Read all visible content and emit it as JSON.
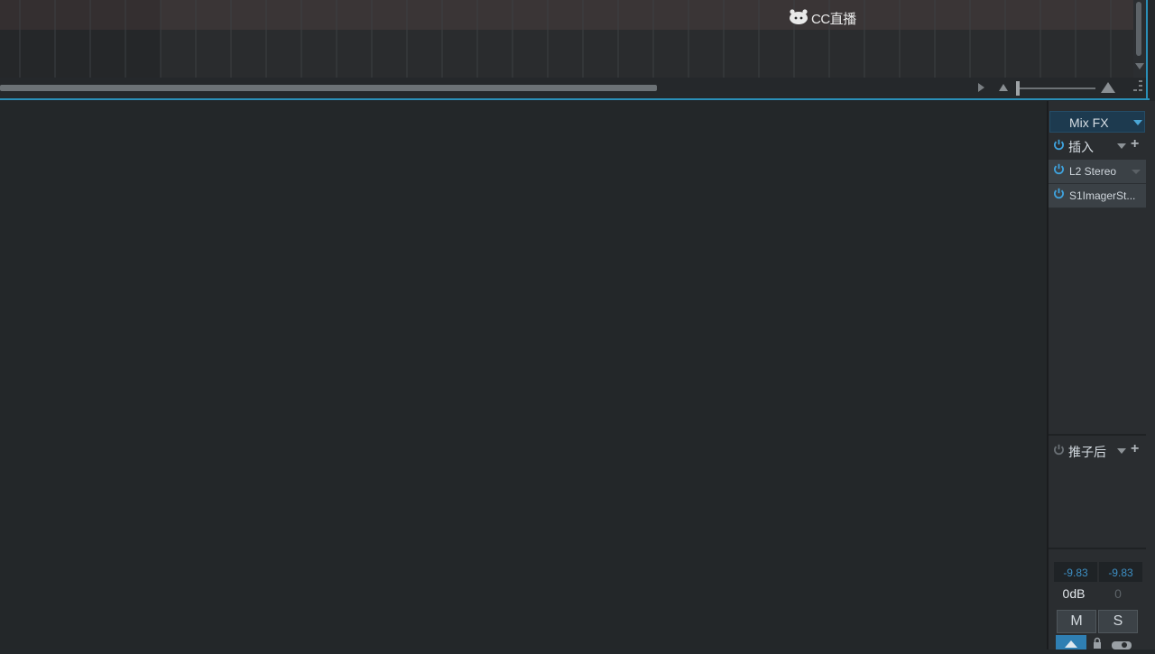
{
  "watermark": {
    "text": "CC直播"
  },
  "mixer": {
    "mixfx_label": "Mix FX",
    "inserts_label": "插入",
    "post_fader_label": "推子后",
    "inserts": [
      {
        "name": "L2 Stereo"
      },
      {
        "name": "S1ImagerSt..."
      }
    ],
    "meter_left": "-9.83",
    "meter_right": "-9.83",
    "volume": "0dB",
    "pan": "0",
    "mute_label": "M",
    "solo_label": "S"
  },
  "colors": {
    "accent": "#2a8fb8",
    "power_on": "#3fa2dd",
    "meter_text": "#3d8fc4",
    "panel_bg": "#2a2d30",
    "main_bg": "#232729"
  },
  "icons": [
    "cc-logo-icon",
    "power-icon",
    "dropdown-arrow-icon",
    "plus-icon",
    "play-arrow-icon",
    "zoom-out-icon",
    "zoom-in-icon",
    "grip-icon"
  ]
}
